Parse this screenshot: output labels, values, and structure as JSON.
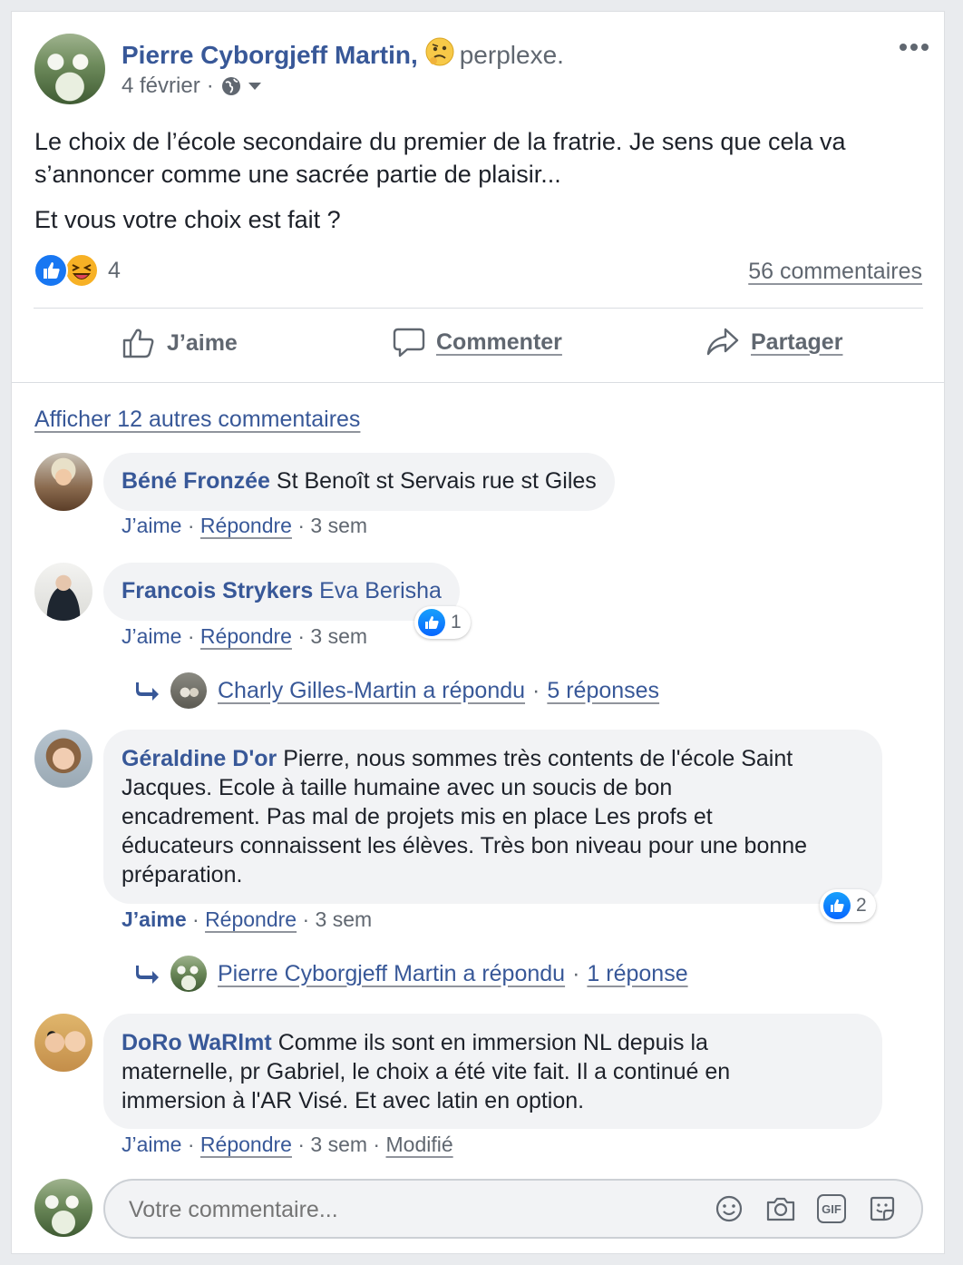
{
  "post": {
    "author": "Pierre Cyborgjeff Martin,",
    "feeling": "perplexe.",
    "date": "4 février",
    "separator": "·",
    "text_line1": "Le choix de l’école secondaire du premier de la fratrie. Je sens que cela va",
    "text_line2": "s’annoncer comme une sacrée partie de plaisir...",
    "text_line3": "Et vous votre choix est fait ?",
    "reaction_count": "4",
    "comments_count": "56 commentaires",
    "more_icon": "more-dots-icon"
  },
  "actions": {
    "like": "J’aime",
    "comment": "Commenter",
    "share": "Partager"
  },
  "comments_section": {
    "more_comments": "Afficher 12 autres commentaires",
    "comments": [
      {
        "name": "Béné Fronzée",
        "text": "St Benoît st Servais rue st Giles",
        "like": "J’aime",
        "reply": "Répondre",
        "time": "3 sem"
      },
      {
        "name": "Francois Strykers",
        "text": "Eva Berisha",
        "like": "J’aime",
        "reply": "Répondre",
        "time": "3 sem",
        "reactions": "1",
        "replies_author": "Charly Gilles-Martin a répondu",
        "replies_count": "5 réponses"
      },
      {
        "name": "Géraldine D'or",
        "text_line1": "Pierre, nous sommes très contents de l'école Saint",
        "text_line2": "Jacques. Ecole à taille humaine avec un soucis de bon",
        "text_line3": "encadrement. Pas mal de projets mis en place Les profs et",
        "text_line4": "éducateurs connaissent les élèves. Très bon niveau pour une bonne",
        "text_line5": "préparation.",
        "like": "J’aime",
        "reply": "Répondre",
        "time": "3 sem",
        "reactions": "2",
        "replies_author": "Pierre Cyborgjeff Martin a répondu",
        "replies_count": "1 réponse"
      },
      {
        "name": "DoRo WaRlmt",
        "text_line1": "Comme ils sont en immersion NL depuis la",
        "text_line2": "maternelle, pr Gabriel, le choix a été vite fait. Il a continué en",
        "text_line3": "immersion à l'AR Visé. Et avec latin en option.",
        "like": "J’aime",
        "reply": "Répondre",
        "time": "3 sem",
        "edited": "Modifié"
      }
    ]
  },
  "composer": {
    "placeholder": "Votre commentaire...",
    "gif_label": "GIF"
  },
  "colors": {
    "link": "#385898",
    "background": "#e9ebee",
    "bubble": "#f2f3f5",
    "like_blue": "#0866ff"
  }
}
